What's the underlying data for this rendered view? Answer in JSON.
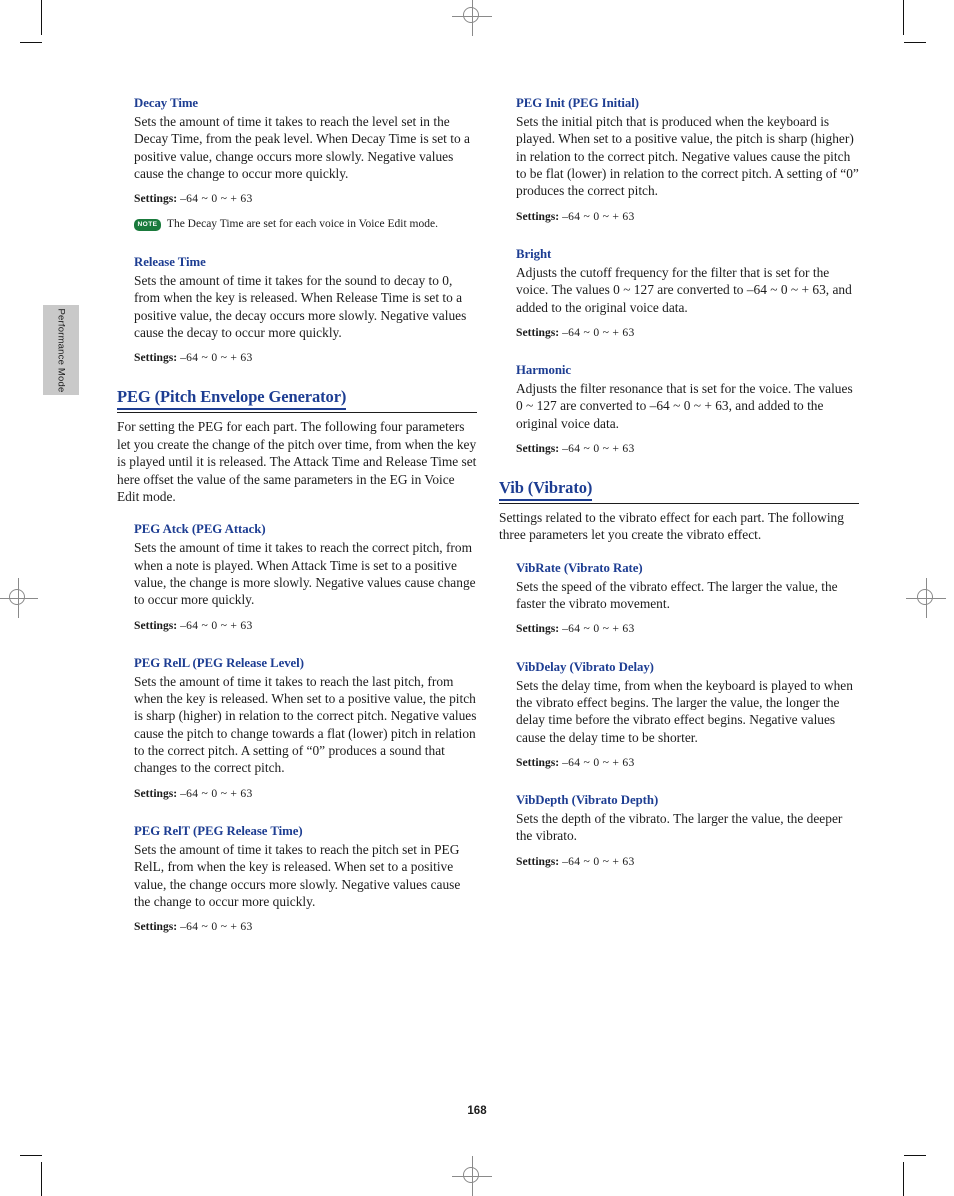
{
  "page": {
    "number": "168",
    "side_tab_label": "Performance Mode"
  },
  "settings_label": "Settings:",
  "left_column": {
    "entries": [
      {
        "type": "sub",
        "heading": "Decay Time",
        "body": "Sets the amount of time it takes to reach the level set in the Decay Time, from the peak level. When Decay Time is set to a positive value, change occurs more slowly. Negative values cause the change to occur more quickly.",
        "settings": "–64 ~ 0 ~ + 63",
        "note": "The Decay Time are set for each voice in Voice Edit mode.",
        "note_badge": "NOTE"
      },
      {
        "type": "sub",
        "heading": "Release Time",
        "body": "Sets the amount of time it takes for the sound to decay to 0, from when the key is released. When Release Time is set to a positive value, the decay occurs more slowly. Negative values cause the decay to occur more quickly.",
        "settings": "–64 ~ 0 ~ + 63"
      },
      {
        "type": "section",
        "heading": "PEG (Pitch Envelope Generator)",
        "body": "For setting the PEG for each part. The following four parameters let you create the change of the pitch over time, from when the key is played until it is released. The Attack Time and Release Time set here offset the value of the same parameters in the EG in Voice Edit mode."
      },
      {
        "type": "sub",
        "heading": "PEG Atck (PEG Attack)",
        "body": "Sets the amount of time it takes to reach the correct pitch, from when a note is played. When Attack Time is set to a positive value, the change is more slowly. Negative values cause change to occur more quickly.",
        "settings": "–64 ~ 0 ~ + 63"
      },
      {
        "type": "sub",
        "heading": "PEG RelL (PEG Release Level)",
        "body": "Sets the amount of time it takes to reach the last pitch, from when the key is released. When set to a positive value, the pitch is sharp (higher) in relation to the correct pitch. Negative values cause the pitch to change towards a flat (lower) pitch in relation to the correct pitch. A setting of “0” produces a sound that changes to the correct pitch.",
        "settings": "–64 ~ 0 ~ + 63"
      },
      {
        "type": "sub",
        "heading": "PEG RelT (PEG Release Time)",
        "body": "Sets the amount of time it takes to reach the pitch set in PEG RelL, from when the key is released. When set to a positive value, the change occurs more slowly. Negative values cause the change to occur more quickly.",
        "settings": "–64 ~ 0 ~ + 63"
      }
    ]
  },
  "right_column": {
    "entries": [
      {
        "type": "sub",
        "heading": "PEG Init (PEG Initial)",
        "body": "Sets the initial pitch that is produced when the keyboard is played. When set to a positive value, the pitch is sharp (higher) in relation to the correct pitch. Negative values cause the pitch to be flat (lower) in relation to the correct pitch. A setting of “0” produces the correct pitch.",
        "settings": "–64 ~ 0 ~ + 63"
      },
      {
        "type": "sub",
        "heading": "Bright",
        "body": "Adjusts the cutoff frequency for the filter that is set for the voice. The values 0 ~ 127 are converted to –64 ~ 0 ~ + 63, and added to the original voice data.",
        "settings": "–64 ~ 0 ~ + 63"
      },
      {
        "type": "sub",
        "heading": "Harmonic",
        "body": "Adjusts the filter resonance that is set for the voice. The values 0 ~ 127 are converted to –64 ~ 0 ~ + 63, and added to the original voice data.",
        "settings": "–64 ~ 0 ~ + 63"
      },
      {
        "type": "section",
        "heading": "Vib (Vibrato)",
        "body": "Settings related to the vibrato effect for each part. The following three parameters let you create the vibrato effect."
      },
      {
        "type": "sub",
        "heading": "VibRate (Vibrato Rate)",
        "body": "Sets the speed of the vibrato effect. The larger the value, the faster the vibrato movement.",
        "settings": "–64 ~ 0 ~ + 63"
      },
      {
        "type": "sub",
        "heading": "VibDelay (Vibrato Delay)",
        "body": "Sets the delay time, from when the keyboard is played to when the vibrato effect begins. The larger the value, the longer the delay time before the vibrato effect begins. Negative values cause the delay time to be shorter.",
        "settings": "–64 ~ 0 ~ + 63"
      },
      {
        "type": "sub",
        "heading": "VibDepth (Vibrato Depth)",
        "body": "Sets the depth of the vibrato. The larger the value, the deeper the vibrato.",
        "settings": "–64 ~ 0 ~ + 63"
      }
    ]
  },
  "colors": {
    "heading_blue": "#1d3d92",
    "note_green": "#1a7a3c",
    "tab_gray": "#c9c9c9",
    "text": "#1c1c1c"
  }
}
